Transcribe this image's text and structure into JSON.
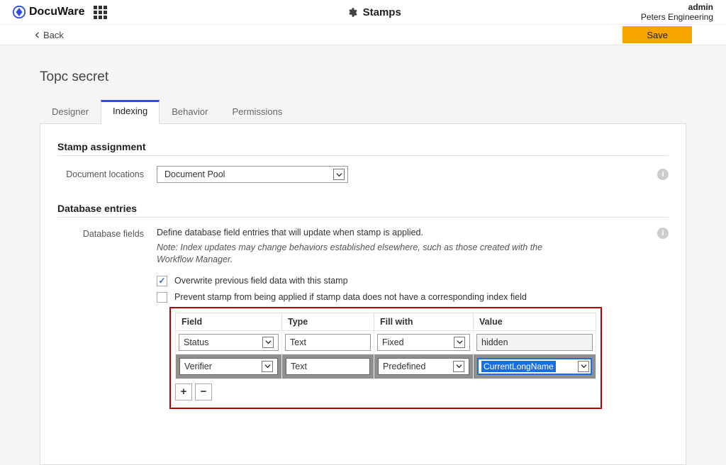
{
  "brand": "DocuWare",
  "header": {
    "title": "Stamps"
  },
  "user": {
    "name": "admin",
    "org": "Peters Engineering"
  },
  "actions": {
    "back": "Back",
    "save": "Save"
  },
  "page": {
    "title": "Topc secret",
    "tabs": {
      "designer": "Designer",
      "indexing": "Indexing",
      "behavior": "Behavior",
      "permissions": "Permissions"
    }
  },
  "assignment": {
    "heading": "Stamp assignment",
    "locations_label": "Document locations",
    "locations_value": "Document Pool"
  },
  "database": {
    "heading": "Database entries",
    "fields_label": "Database fields",
    "description": "Define database field entries that will update when stamp is applied.",
    "note": "Note: Index updates may change behaviors established elsewhere, such as those created with the Workflow Manager.",
    "overwrite_label": "Overwrite previous field data with this stamp",
    "overwrite_checked": true,
    "prevent_label": "Prevent stamp from being applied if stamp data does not have a corresponding index field",
    "prevent_checked": false,
    "table": {
      "headers": {
        "field": "Field",
        "type": "Type",
        "fill": "Fill with",
        "value": "Value"
      },
      "rows": [
        {
          "field": "Status",
          "type": "Text",
          "fill": "Fixed",
          "value": "hidden"
        },
        {
          "field": "Verifier",
          "type": "Text",
          "fill": "Predefined",
          "value": "CurrentLongName"
        }
      ]
    }
  }
}
